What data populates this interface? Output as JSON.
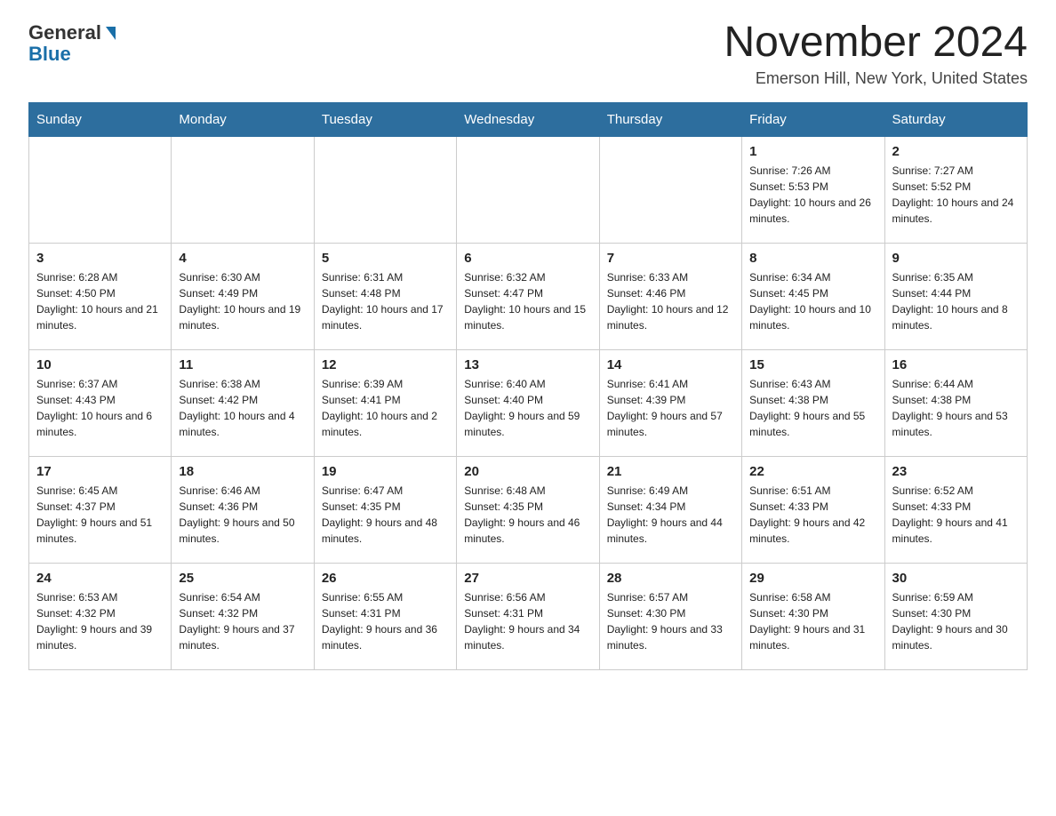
{
  "header": {
    "logo_general": "General",
    "logo_blue": "Blue",
    "title": "November 2024",
    "location": "Emerson Hill, New York, United States"
  },
  "weekdays": [
    "Sunday",
    "Monday",
    "Tuesday",
    "Wednesday",
    "Thursday",
    "Friday",
    "Saturday"
  ],
  "weeks": [
    [
      {
        "day": "",
        "sunrise": "",
        "sunset": "",
        "daylight": ""
      },
      {
        "day": "",
        "sunrise": "",
        "sunset": "",
        "daylight": ""
      },
      {
        "day": "",
        "sunrise": "",
        "sunset": "",
        "daylight": ""
      },
      {
        "day": "",
        "sunrise": "",
        "sunset": "",
        "daylight": ""
      },
      {
        "day": "",
        "sunrise": "",
        "sunset": "",
        "daylight": ""
      },
      {
        "day": "1",
        "sunrise": "Sunrise: 7:26 AM",
        "sunset": "Sunset: 5:53 PM",
        "daylight": "Daylight: 10 hours and 26 minutes."
      },
      {
        "day": "2",
        "sunrise": "Sunrise: 7:27 AM",
        "sunset": "Sunset: 5:52 PM",
        "daylight": "Daylight: 10 hours and 24 minutes."
      }
    ],
    [
      {
        "day": "3",
        "sunrise": "Sunrise: 6:28 AM",
        "sunset": "Sunset: 4:50 PM",
        "daylight": "Daylight: 10 hours and 21 minutes."
      },
      {
        "day": "4",
        "sunrise": "Sunrise: 6:30 AM",
        "sunset": "Sunset: 4:49 PM",
        "daylight": "Daylight: 10 hours and 19 minutes."
      },
      {
        "day": "5",
        "sunrise": "Sunrise: 6:31 AM",
        "sunset": "Sunset: 4:48 PM",
        "daylight": "Daylight: 10 hours and 17 minutes."
      },
      {
        "day": "6",
        "sunrise": "Sunrise: 6:32 AM",
        "sunset": "Sunset: 4:47 PM",
        "daylight": "Daylight: 10 hours and 15 minutes."
      },
      {
        "day": "7",
        "sunrise": "Sunrise: 6:33 AM",
        "sunset": "Sunset: 4:46 PM",
        "daylight": "Daylight: 10 hours and 12 minutes."
      },
      {
        "day": "8",
        "sunrise": "Sunrise: 6:34 AM",
        "sunset": "Sunset: 4:45 PM",
        "daylight": "Daylight: 10 hours and 10 minutes."
      },
      {
        "day": "9",
        "sunrise": "Sunrise: 6:35 AM",
        "sunset": "Sunset: 4:44 PM",
        "daylight": "Daylight: 10 hours and 8 minutes."
      }
    ],
    [
      {
        "day": "10",
        "sunrise": "Sunrise: 6:37 AM",
        "sunset": "Sunset: 4:43 PM",
        "daylight": "Daylight: 10 hours and 6 minutes."
      },
      {
        "day": "11",
        "sunrise": "Sunrise: 6:38 AM",
        "sunset": "Sunset: 4:42 PM",
        "daylight": "Daylight: 10 hours and 4 minutes."
      },
      {
        "day": "12",
        "sunrise": "Sunrise: 6:39 AM",
        "sunset": "Sunset: 4:41 PM",
        "daylight": "Daylight: 10 hours and 2 minutes."
      },
      {
        "day": "13",
        "sunrise": "Sunrise: 6:40 AM",
        "sunset": "Sunset: 4:40 PM",
        "daylight": "Daylight: 9 hours and 59 minutes."
      },
      {
        "day": "14",
        "sunrise": "Sunrise: 6:41 AM",
        "sunset": "Sunset: 4:39 PM",
        "daylight": "Daylight: 9 hours and 57 minutes."
      },
      {
        "day": "15",
        "sunrise": "Sunrise: 6:43 AM",
        "sunset": "Sunset: 4:38 PM",
        "daylight": "Daylight: 9 hours and 55 minutes."
      },
      {
        "day": "16",
        "sunrise": "Sunrise: 6:44 AM",
        "sunset": "Sunset: 4:38 PM",
        "daylight": "Daylight: 9 hours and 53 minutes."
      }
    ],
    [
      {
        "day": "17",
        "sunrise": "Sunrise: 6:45 AM",
        "sunset": "Sunset: 4:37 PM",
        "daylight": "Daylight: 9 hours and 51 minutes."
      },
      {
        "day": "18",
        "sunrise": "Sunrise: 6:46 AM",
        "sunset": "Sunset: 4:36 PM",
        "daylight": "Daylight: 9 hours and 50 minutes."
      },
      {
        "day": "19",
        "sunrise": "Sunrise: 6:47 AM",
        "sunset": "Sunset: 4:35 PM",
        "daylight": "Daylight: 9 hours and 48 minutes."
      },
      {
        "day": "20",
        "sunrise": "Sunrise: 6:48 AM",
        "sunset": "Sunset: 4:35 PM",
        "daylight": "Daylight: 9 hours and 46 minutes."
      },
      {
        "day": "21",
        "sunrise": "Sunrise: 6:49 AM",
        "sunset": "Sunset: 4:34 PM",
        "daylight": "Daylight: 9 hours and 44 minutes."
      },
      {
        "day": "22",
        "sunrise": "Sunrise: 6:51 AM",
        "sunset": "Sunset: 4:33 PM",
        "daylight": "Daylight: 9 hours and 42 minutes."
      },
      {
        "day": "23",
        "sunrise": "Sunrise: 6:52 AM",
        "sunset": "Sunset: 4:33 PM",
        "daylight": "Daylight: 9 hours and 41 minutes."
      }
    ],
    [
      {
        "day": "24",
        "sunrise": "Sunrise: 6:53 AM",
        "sunset": "Sunset: 4:32 PM",
        "daylight": "Daylight: 9 hours and 39 minutes."
      },
      {
        "day": "25",
        "sunrise": "Sunrise: 6:54 AM",
        "sunset": "Sunset: 4:32 PM",
        "daylight": "Daylight: 9 hours and 37 minutes."
      },
      {
        "day": "26",
        "sunrise": "Sunrise: 6:55 AM",
        "sunset": "Sunset: 4:31 PM",
        "daylight": "Daylight: 9 hours and 36 minutes."
      },
      {
        "day": "27",
        "sunrise": "Sunrise: 6:56 AM",
        "sunset": "Sunset: 4:31 PM",
        "daylight": "Daylight: 9 hours and 34 minutes."
      },
      {
        "day": "28",
        "sunrise": "Sunrise: 6:57 AM",
        "sunset": "Sunset: 4:30 PM",
        "daylight": "Daylight: 9 hours and 33 minutes."
      },
      {
        "day": "29",
        "sunrise": "Sunrise: 6:58 AM",
        "sunset": "Sunset: 4:30 PM",
        "daylight": "Daylight: 9 hours and 31 minutes."
      },
      {
        "day": "30",
        "sunrise": "Sunrise: 6:59 AM",
        "sunset": "Sunset: 4:30 PM",
        "daylight": "Daylight: 9 hours and 30 minutes."
      }
    ]
  ]
}
